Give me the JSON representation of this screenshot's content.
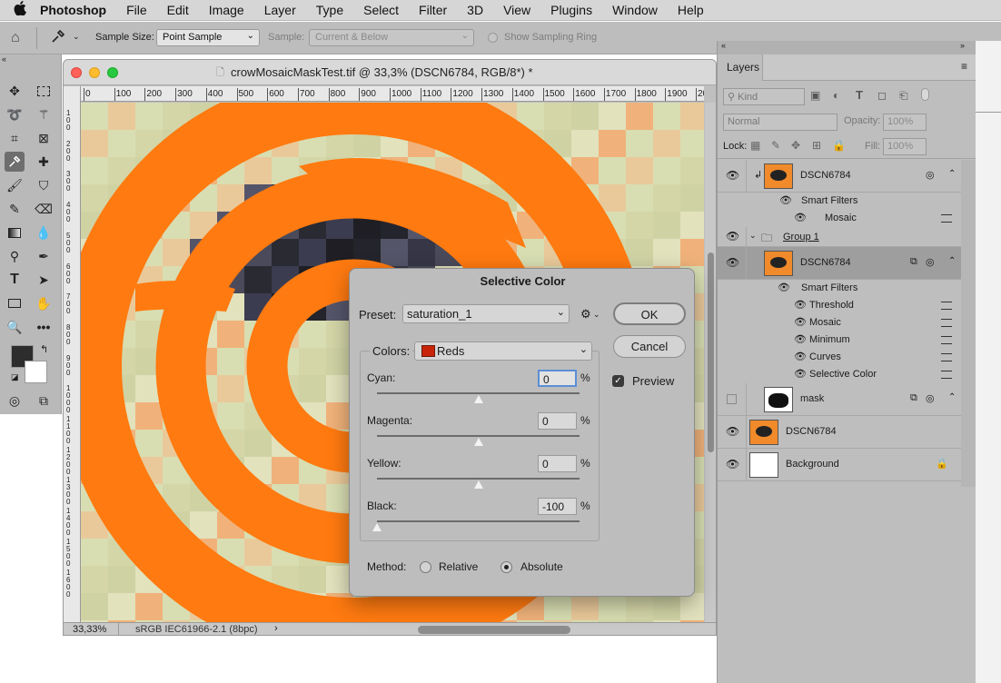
{
  "menubar": {
    "apple": "",
    "items": [
      "Photoshop",
      "File",
      "Edit",
      "Image",
      "Layer",
      "Type",
      "Select",
      "Filter",
      "3D",
      "View",
      "Plugins",
      "Window",
      "Help"
    ]
  },
  "options": {
    "sample_size_label": "Sample Size:",
    "sample_size_value": "Point Sample",
    "sample_label": "Sample:",
    "sample_value": "Current & Below",
    "show_ring_label": "Show Sampling Ring"
  },
  "document": {
    "title": "crowMosaicMaskTest.tif @ 33,3% (DSCN6784, RGB/8*) *",
    "zoom": "33,33%",
    "profile": "sRGB IEC61966-2.1 (8bpc)",
    "ruler_h": [
      "0",
      "100",
      "200",
      "300",
      "400",
      "500",
      "600",
      "700",
      "800",
      "900",
      "1000",
      "1100",
      "1200",
      "1300",
      "1400",
      "1500",
      "1600",
      "1700",
      "1800",
      "1900",
      "200"
    ],
    "ruler_v": [
      "1\n0\n0",
      "2\n0\n0",
      "3\n0\n0",
      "4\n0\n0",
      "5\n0\n0",
      "6\n0\n0",
      "7\n0\n0",
      "8\n0\n0",
      "9\n0\n0",
      "1\n0\n0\n0",
      "1\n1\n0\n0",
      "1\n2\n0\n0",
      "1\n3\n0\n0",
      "1\n4\n0\n0",
      "1\n5\n0\n0",
      "1\n6\n0\n0"
    ]
  },
  "dialog": {
    "title": "Selective Color",
    "preset_label": "Preset:",
    "preset_value": "saturation_1",
    "colors_label": "Colors:",
    "colors_value": "Reds",
    "colors_swatch": "#c8240a",
    "sliders": [
      {
        "label": "Cyan:",
        "value": "0",
        "level": 0
      },
      {
        "label": "Magenta:",
        "value": "0",
        "level": 0
      },
      {
        "label": "Yellow:",
        "value": "0",
        "level": 0
      },
      {
        "label": "Black:",
        "value": "-100",
        "level": -100
      }
    ],
    "percent": "%",
    "ok": "OK",
    "cancel": "Cancel",
    "preview": "Preview",
    "method_label": "Method:",
    "relative": "Relative",
    "absolute": "Absolute",
    "method_selected": "Absolute"
  },
  "layers": {
    "tab": "Layers",
    "filter_kind": "Kind",
    "blend": "Normal",
    "opacity_label": "Opacity:",
    "opacity": "100%",
    "lock_label": "Lock:",
    "fill_label": "Fill:",
    "fill": "100%",
    "rows": [
      {
        "name": "DSCN6784",
        "kind": "smart",
        "visible": true
      },
      {
        "name": "Smart Filters",
        "kind": "sf"
      },
      {
        "name": "Mosaic",
        "kind": "fx"
      },
      {
        "name": "Group 1",
        "kind": "group",
        "visible": true
      },
      {
        "name": "DSCN6784",
        "kind": "smart",
        "visible": true,
        "selected": true
      },
      {
        "name": "Smart Filters",
        "kind": "sf"
      },
      {
        "name": "Threshold",
        "kind": "fx"
      },
      {
        "name": "Mosaic",
        "kind": "fx"
      },
      {
        "name": "Minimum",
        "kind": "fx"
      },
      {
        "name": "Curves",
        "kind": "fx"
      },
      {
        "name": "Selective Color",
        "kind": "fx"
      },
      {
        "name": "mask",
        "kind": "smart",
        "visible": false
      },
      {
        "name": "DSCN6784",
        "kind": "image",
        "visible": true
      },
      {
        "name": "Background",
        "kind": "bg",
        "visible": true
      }
    ]
  },
  "colors": {
    "orange": "#ff7a10",
    "accent": "#4a90e2",
    "mosaic_light": "#d9dfb4"
  }
}
